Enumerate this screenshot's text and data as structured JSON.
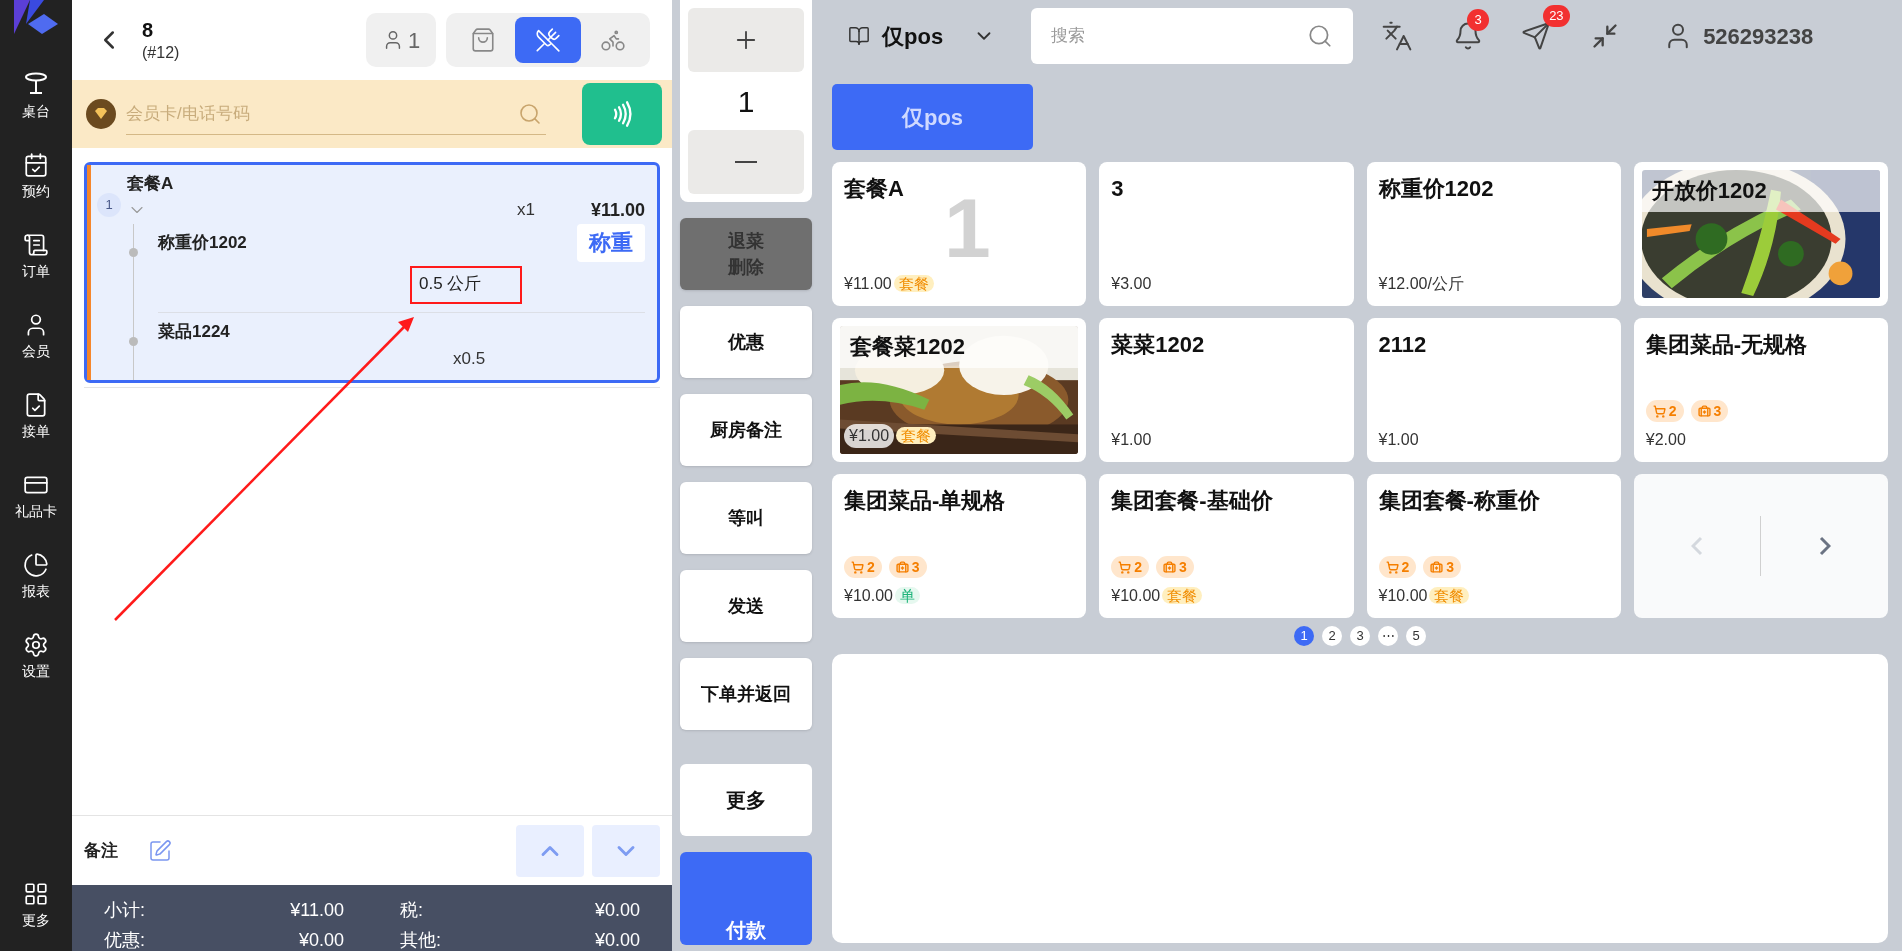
{
  "sidebar": {
    "items": [
      {
        "label": "桌台"
      },
      {
        "label": "预约"
      },
      {
        "label": "订单"
      },
      {
        "label": "会员"
      },
      {
        "label": "接单"
      },
      {
        "label": "礼品卡"
      },
      {
        "label": "报表"
      },
      {
        "label": "设置"
      }
    ],
    "more": {
      "label": "更多"
    }
  },
  "order": {
    "table": "8",
    "number": "(#12)",
    "guests": "1",
    "modes": [
      {
        "selected": false
      },
      {
        "selected": true
      },
      {
        "selected": false
      }
    ]
  },
  "member": {
    "placeholder": "会员卡/电话号码"
  },
  "items": [
    {
      "index": "1",
      "name": "套餐A",
      "qty": "x1",
      "price": "¥11.00",
      "selected": true,
      "children": [
        {
          "name": "称重价1202",
          "weight": "0.5 公斤",
          "action": "称重"
        },
        {
          "name": "菜品1224",
          "qty": "x0.5"
        }
      ]
    }
  ],
  "note": {
    "label": "备注"
  },
  "summary": [
    {
      "label": "小计:",
      "value": "¥11.00"
    },
    {
      "label": "税:",
      "value": "¥0.00"
    },
    {
      "label": "优惠:",
      "value": "¥0.00"
    },
    {
      "label": "其他:",
      "value": "¥0.00"
    }
  ],
  "quantity": {
    "value": "1"
  },
  "actions": [
    {
      "label": "退菜删除",
      "disabled": true
    },
    {
      "label": "优惠",
      "disabled": false
    },
    {
      "label": "厨房备注",
      "disabled": false
    },
    {
      "label": "等叫",
      "disabled": false
    },
    {
      "label": "发送",
      "disabled": false
    },
    {
      "label": "下单并返回",
      "disabled": false
    }
  ],
  "footer_actions": [
    {
      "label": "更多",
      "kind": "plain"
    },
    {
      "label": "付款",
      "kind": "primary"
    }
  ],
  "topbar": {
    "store": "仅pos",
    "search_placeholder": "搜索",
    "notifications": "3",
    "messages": "23",
    "user": "526293238"
  },
  "categories": [
    {
      "label": "仅pos",
      "selected": true
    }
  ],
  "products": [
    {
      "name": "套餐A",
      "price": "¥11.00",
      "tag": {
        "label": "套餐",
        "kind": "combo"
      },
      "count": "1"
    },
    {
      "name": "3",
      "price": "¥3.00"
    },
    {
      "name": "称重价1202",
      "price": "¥12.00/公斤"
    },
    {
      "name": "开放价1202",
      "kind": "picture"
    },
    {
      "name": "套餐菜1202",
      "price": "¥1.00",
      "tag": {
        "label": "套餐",
        "kind": "combo"
      },
      "kind": "picture"
    },
    {
      "name": "菜菜1202",
      "price": "¥1.00"
    },
    {
      "name": "2112",
      "price": "¥1.00"
    },
    {
      "name": "集团菜品-无规格",
      "price": "¥2.00",
      "badges": [
        {
          "count": "2",
          "kind": "cart"
        },
        {
          "count": "3",
          "kind": "bag"
        }
      ]
    },
    {
      "name": "集团菜品-单规格",
      "price": "¥10.00",
      "tag": {
        "label": "单",
        "kind": "single"
      },
      "badges": [
        {
          "count": "2",
          "kind": "cart"
        },
        {
          "count": "3",
          "kind": "bag"
        }
      ]
    },
    {
      "name": "集团套餐-基础价",
      "price": "¥10.00",
      "tag": {
        "label": "套餐",
        "kind": "combo"
      },
      "badges": [
        {
          "count": "2",
          "kind": "cart"
        },
        {
          "count": "3",
          "kind": "bag"
        }
      ]
    },
    {
      "name": "集团套餐-称重价",
      "price": "¥10.00",
      "tag": {
        "label": "套餐",
        "kind": "combo"
      },
      "badges": [
        {
          "count": "2",
          "kind": "cart"
        },
        {
          "count": "3",
          "kind": "bag"
        }
      ]
    }
  ],
  "pager": {
    "prev_disabled": true,
    "next_disabled": false
  },
  "pages": [
    {
      "label": "1",
      "selected": true
    },
    {
      "label": "2",
      "selected": false
    },
    {
      "label": "3",
      "selected": false
    },
    {
      "label": "⋯",
      "selected": false
    },
    {
      "label": "5",
      "selected": false
    }
  ]
}
